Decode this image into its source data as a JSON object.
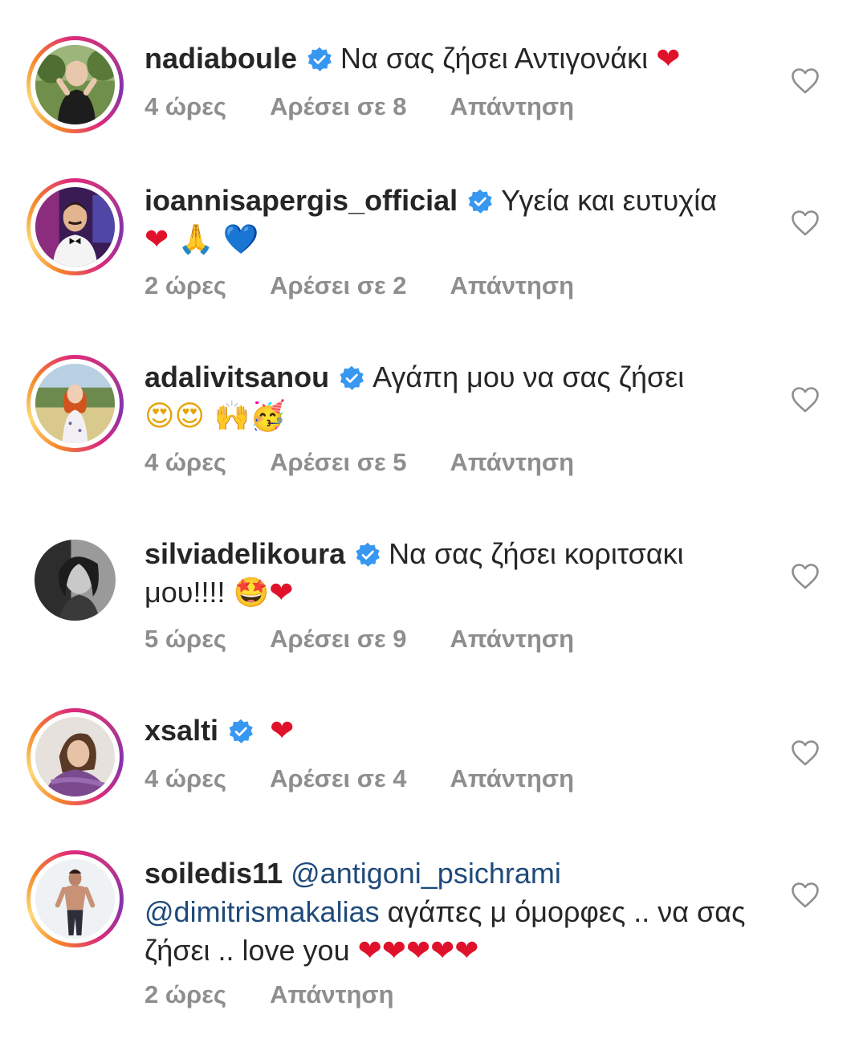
{
  "comments": [
    {
      "username": "nadiaboule",
      "verified": true,
      "text": "Να σας ζήσει Αντιγονάκι",
      "emojis": "❤",
      "time": "4 ώρες",
      "likes": "Αρέσει σε 8",
      "reply": "Απάντηση",
      "avatar_icon": "woman-outdoors-photo",
      "story_ring": true
    },
    {
      "username": "ioannisapergis_official",
      "verified": true,
      "text": "Υγεία και ευτυχία",
      "emojis": "❤ 🙏 💙",
      "time": "2 ώρες",
      "likes": "Αρέσει σε 2",
      "reply": "Απάντηση",
      "avatar_icon": "man-bowtie-photo",
      "story_ring": true
    },
    {
      "username": "adalivitsanou",
      "verified": true,
      "text": "Αγάπη μου να σας ζήσει",
      "emojis": "😍😍 🙌🥳",
      "time": "4 ώρες",
      "likes": "Αρέσει σε 5",
      "reply": "Απάντηση",
      "avatar_icon": "woman-field-photo",
      "story_ring": true
    },
    {
      "username": "silviadelikoura",
      "verified": true,
      "text": "Να σας ζήσει κοριτσακι μου!!!!",
      "emojis": "🤩❤",
      "time": "5 ώρες",
      "likes": "Αρέσει σε 9",
      "reply": "Απάντηση",
      "avatar_icon": "woman-bw-photo",
      "story_ring": false
    },
    {
      "username": "xsalti",
      "verified": true,
      "text": "",
      "emojis": "❤",
      "time": "4 ώρες",
      "likes": "Αρέσει σε 4",
      "reply": "Απάντηση",
      "avatar_icon": "woman-portrait-photo",
      "story_ring": true
    },
    {
      "username": "soiledis11",
      "verified": false,
      "mention1": "@antigoni_psichrami",
      "mention2": "@dimitrismakalias",
      "text": "αγάπες μ όμορφες .. να σας ζήσει .. love you",
      "emojis": "❤❤❤❤❤",
      "time": "2 ώρες",
      "likes": "",
      "reply": "Απάντηση",
      "avatar_icon": "man-shirtless-photo",
      "story_ring": true
    }
  ],
  "colors": {
    "text": "#262626",
    "meta": "#8e8e8e",
    "mention": "#1f4a7a",
    "verified": "#3897f0",
    "heart": "#e0122b"
  }
}
